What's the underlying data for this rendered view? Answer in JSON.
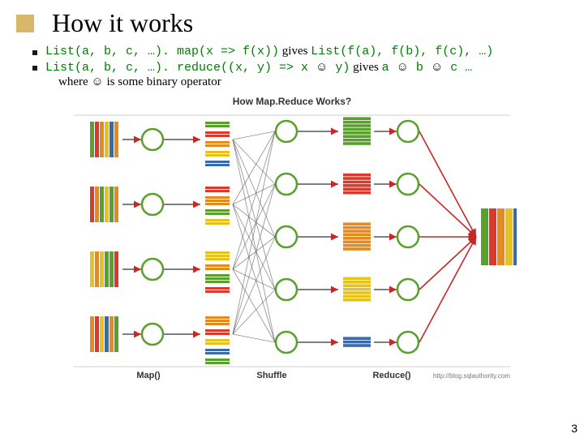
{
  "title": "How it works",
  "bullets": [
    {
      "code1": "List(a, b, c, …). map(x => f(x))",
      "t1": " gives ",
      "code2": "List(f(a), f(b), f(c), …)"
    },
    {
      "code1": "List(a, b, c, …). reduce((x, y) => x ",
      "s1": "☺",
      "code2": " y)",
      "t1": " gives ",
      "code3": "a ",
      "s2": "☺",
      "code4": " b ",
      "s3": "☺",
      "code5": " c … "
    }
  ],
  "bullet_hang_pre": "where ",
  "bullet_hang_smile": "☺",
  "bullet_hang_post": " is some binary operator",
  "diagram": {
    "title": "How Map.Reduce Works?",
    "labels": {
      "map": "Map()",
      "shuffle": "Shuffle",
      "reduce": "Reduce()"
    },
    "attribution": "http://blog.sqlauthority.com",
    "colors": {
      "green": "#5aa02c",
      "red": "#d93a2b",
      "orange": "#e58a1f",
      "yellow": "#e7c21e",
      "blue": "#3a6aa8",
      "stroke": "#555555",
      "arrow_red": "#c62828"
    },
    "inputs": [
      [
        "green",
        "red",
        "orange",
        "yellow",
        "blue",
        "orange"
      ],
      [
        "red",
        "orange",
        "green",
        "yellow",
        "green",
        "orange"
      ],
      [
        "yellow",
        "orange",
        "yellow",
        "green",
        "green",
        "red"
      ],
      [
        "orange",
        "red",
        "yellow",
        "blue",
        "orange",
        "green"
      ]
    ],
    "map_out": [
      [
        [
          "green",
          "green"
        ],
        [
          "red",
          "red"
        ],
        [
          "orange",
          "orange"
        ],
        [
          "yellow",
          "yellow"
        ],
        [
          "blue",
          "blue"
        ]
      ],
      [
        [
          "red",
          "red"
        ],
        [
          "orange",
          "orange",
          "orange"
        ],
        [
          "green",
          "green"
        ],
        [
          "yellow",
          "yellow"
        ]
      ],
      [
        [
          "yellow",
          "yellow",
          "yellow"
        ],
        [
          "orange",
          "orange"
        ],
        [
          "green",
          "green",
          "green"
        ],
        [
          "red",
          "red"
        ]
      ],
      [
        [
          "orange",
          "orange",
          "orange"
        ],
        [
          "red",
          "red"
        ],
        [
          "yellow",
          "yellow"
        ],
        [
          "blue",
          "blue"
        ],
        [
          "green",
          "green"
        ]
      ]
    ],
    "shuffle_out": [
      {
        "color": "green",
        "count": 8
      },
      {
        "color": "red",
        "count": 6
      },
      {
        "color": "orange",
        "count": 8
      },
      {
        "color": "yellow",
        "count": 7
      },
      {
        "color": "blue",
        "count": 3
      }
    ],
    "final": [
      "green",
      "red",
      "orange",
      "yellow",
      "blue"
    ]
  },
  "page_number": "3"
}
